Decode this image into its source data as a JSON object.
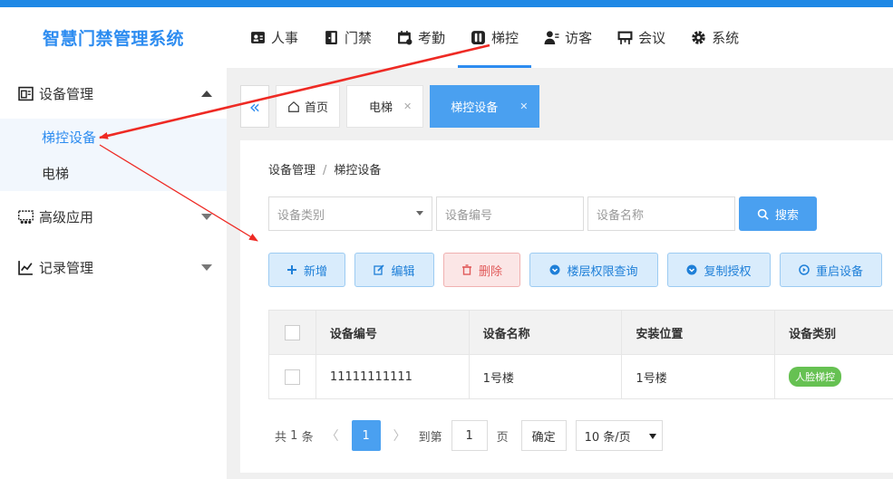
{
  "app": {
    "title": "智慧门禁管理系统"
  },
  "topnav": [
    {
      "label": "人事",
      "icon": "person-card-icon"
    },
    {
      "label": "门禁",
      "icon": "door-icon"
    },
    {
      "label": "考勤",
      "icon": "calendar-clock-icon"
    },
    {
      "label": "梯控",
      "icon": "elevator-icon",
      "active": true
    },
    {
      "label": "访客",
      "icon": "visitor-icon"
    },
    {
      "label": "会议",
      "icon": "meeting-board-icon"
    },
    {
      "label": "系统",
      "icon": "gear-icon"
    }
  ],
  "sidebar": {
    "groups": [
      {
        "label": "设备管理",
        "icon": "device-icon",
        "expanded": true,
        "items": [
          {
            "label": "梯控设备",
            "active": true
          },
          {
            "label": "电梯"
          }
        ]
      },
      {
        "label": "高级应用",
        "icon": "advanced-icon",
        "expanded": false
      },
      {
        "label": "记录管理",
        "icon": "chart-line-icon",
        "expanded": false
      }
    ]
  },
  "tabs": [
    {
      "label": "首页",
      "icon": "home-icon"
    },
    {
      "label": "电梯",
      "closable": true
    },
    {
      "label": "梯控设备",
      "closable": true,
      "active": true
    }
  ],
  "breadcrumb": {
    "parent": "设备管理",
    "separator": "/",
    "current": "梯控设备"
  },
  "filters": {
    "type_placeholder": "设备类别",
    "code_placeholder": "设备编号",
    "name_placeholder": "设备名称",
    "search_label": "搜索"
  },
  "actions": [
    {
      "label": "新增",
      "icon": "plus-icon"
    },
    {
      "label": "编辑",
      "icon": "edit-icon"
    },
    {
      "label": "删除",
      "icon": "trash-icon"
    },
    {
      "label": "楼层权限查询",
      "icon": "chevron-circle-icon"
    },
    {
      "label": "复制授权",
      "icon": "chevron-circle-icon"
    },
    {
      "label": "重启设备",
      "icon": "play-circle-icon"
    }
  ],
  "table": {
    "columns": [
      "设备编号",
      "设备名称",
      "安装位置",
      "设备类别"
    ],
    "rows": [
      {
        "code": "11111111111",
        "name": "1号楼",
        "location": "1号楼",
        "type": "人脸梯控"
      }
    ]
  },
  "pagination": {
    "total_prefix": "共",
    "total": "1",
    "total_suffix": "条",
    "current_page": "1",
    "goto_label": "到第",
    "goto_value": "1",
    "page_unit": "页",
    "confirm_label": "确定",
    "page_size": "10 条/页"
  },
  "colors": {
    "primary": "#2d8cf0",
    "button_blue": "#4aa0f0",
    "badge_green": "#66c152",
    "annotation_red": "#ee2a24"
  }
}
